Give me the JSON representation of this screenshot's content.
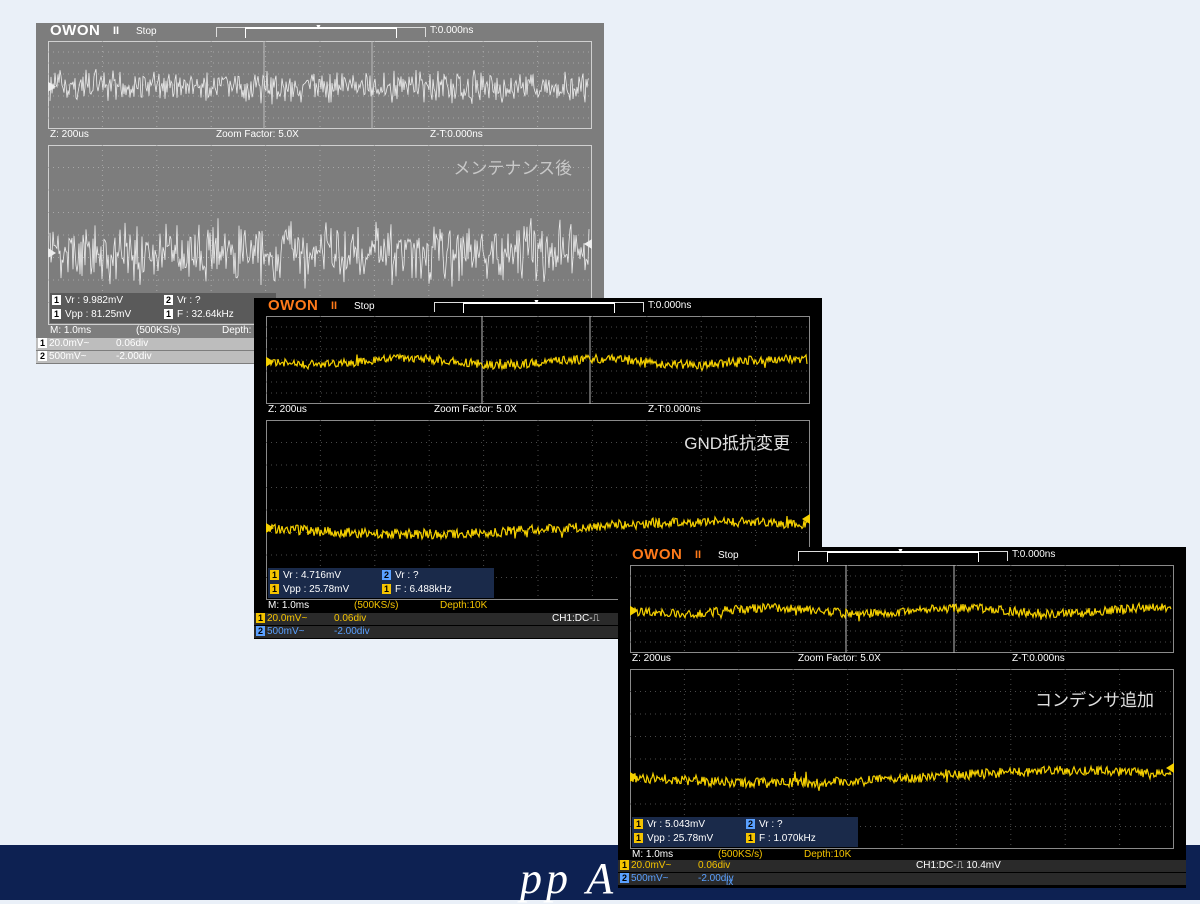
{
  "banner": {
    "text": "pp A"
  },
  "scopes": [
    {
      "logo": "OWON",
      "pause": "II",
      "status": "Stop",
      "t_time": "T:0.000ns",
      "zoom": {
        "z": "Z: 200us",
        "factor": "Zoom Factor: 5.0X",
        "zt": "Z-T:0.000ns"
      },
      "overlay": "メンテナンス後",
      "meas": {
        "vr1_badge": "1",
        "vr1": "Vr : 9.982mV",
        "vr2_badge": "2",
        "vr2": "Vr :     ?",
        "vpp_badge": "1",
        "vpp": "Vpp : 81.25mV",
        "f_badge": "1",
        "f": "F : 32.64kHz"
      },
      "footer": {
        "m": "M: 1.0ms",
        "rate": "(500KS/s)",
        "depth": "Depth:"
      },
      "ch1": {
        "badge": "1",
        "scale": "20.0mV~",
        "offset": "0.06div"
      },
      "ch2": {
        "badge": "2",
        "scale": "500mV~",
        "offset": "-2.00div"
      },
      "trace_color": "#eeeeee"
    },
    {
      "logo": "OWON",
      "pause": "II",
      "status": "Stop",
      "t_time": "T:0.000ns",
      "zoom": {
        "z": "Z: 200us",
        "factor": "Zoom Factor: 5.0X",
        "zt": "Z-T:0.000ns"
      },
      "overlay": "GND抵抗変更",
      "meas": {
        "vr1_badge": "1",
        "vr1": "Vr : 4.716mV",
        "vr2_badge": "2",
        "vr2": "Vr :     ?",
        "vpp_badge": "1",
        "vpp": "Vpp : 25.78mV",
        "f_badge": "1",
        "f": "F : 6.488kHz"
      },
      "footer": {
        "m": "M: 1.0ms",
        "rate": "(500KS/s)",
        "depth": "Depth:10K",
        "trigger": "CH1:DC-⎍"
      },
      "ch1": {
        "badge": "1",
        "scale": "20.0mV~",
        "offset": "0.06div"
      },
      "ch2": {
        "badge": "2",
        "scale": "500mV~",
        "offset": "-2.00div"
      },
      "trace_color": "#f5d000"
    },
    {
      "logo": "OWON",
      "pause": "II",
      "status": "Stop",
      "t_time": "T:0.000ns",
      "zoom": {
        "z": "Z: 200us",
        "factor": "Zoom Factor: 5.0X",
        "zt": "Z-T:0.000ns"
      },
      "overlay": "コンデンサ追加",
      "meas": {
        "vr1_badge": "1",
        "vr1": "Vr : 5.043mV",
        "vr2_badge": "2",
        "vr2": "Vr :     ?",
        "vpp_badge": "1",
        "vpp": "Vpp : 25.78mV",
        "f_badge": "1",
        "f": "F : 1.070kHz"
      },
      "footer": {
        "m": "M: 1.0ms",
        "rate": "(500KS/s)",
        "depth": "Depth:10K",
        "trigger": "CH1:DC-⎍ 10.4mV"
      },
      "ch1": {
        "badge": "1",
        "scale": "20.0mV~",
        "offset": "0.06div"
      },
      "ch2": {
        "badge": "2",
        "scale": "500mV~",
        "offset": "-2.00div",
        "extra": "ix"
      },
      "trace_color": "#f5d000"
    }
  ]
}
